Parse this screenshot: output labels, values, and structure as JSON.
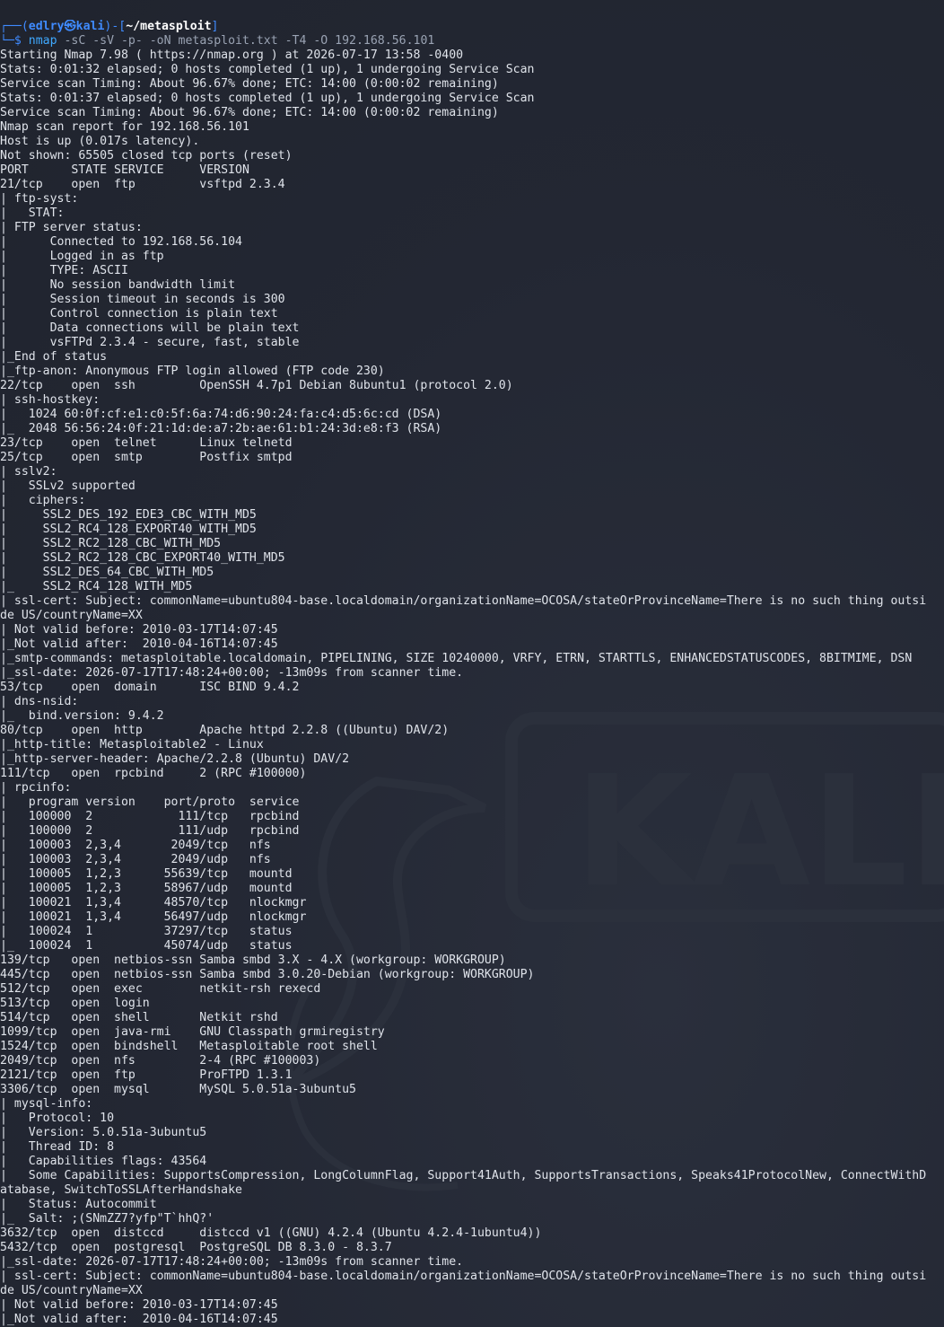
{
  "window": {
    "watermark_text": "KALI"
  },
  "prompt": {
    "open": "┌──(",
    "user": "edlry㉿kali",
    "mid": ")-[",
    "path": "~/metasploit",
    "close": "]",
    "arrow": "└─$ ",
    "command": "nmap",
    "args": " -sC -sV -p- -oN metasploit.txt -T4 -O 192.168.56.101"
  },
  "output_lines": [
    "Starting Nmap 7.98 ( https://nmap.org ) at 2026-07-17 13:58 -0400",
    "Stats: 0:01:32 elapsed; 0 hosts completed (1 up), 1 undergoing Service Scan",
    "Service scan Timing: About 96.67% done; ETC: 14:00 (0:00:02 remaining)",
    "Stats: 0:01:37 elapsed; 0 hosts completed (1 up), 1 undergoing Service Scan",
    "Service scan Timing: About 96.67% done; ETC: 14:00 (0:00:02 remaining)",
    "Nmap scan report for 192.168.56.101",
    "Host is up (0.017s latency).",
    "Not shown: 65505 closed tcp ports (reset)",
    "PORT      STATE SERVICE     VERSION",
    "21/tcp    open  ftp         vsftpd 2.3.4",
    "| ftp-syst:",
    "|   STAT:",
    "| FTP server status:",
    "|      Connected to 192.168.56.104",
    "|      Logged in as ftp",
    "|      TYPE: ASCII",
    "|      No session bandwidth limit",
    "|      Session timeout in seconds is 300",
    "|      Control connection is plain text",
    "|      Data connections will be plain text",
    "|      vsFTPd 2.3.4 - secure, fast, stable",
    "|_End of status",
    "|_ftp-anon: Anonymous FTP login allowed (FTP code 230)",
    "22/tcp    open  ssh         OpenSSH 4.7p1 Debian 8ubuntu1 (protocol 2.0)",
    "| ssh-hostkey:",
    "|   1024 60:0f:cf:e1:c0:5f:6a:74:d6:90:24:fa:c4:d5:6c:cd (DSA)",
    "|_  2048 56:56:24:0f:21:1d:de:a7:2b:ae:61:b1:24:3d:e8:f3 (RSA)",
    "23/tcp    open  telnet      Linux telnetd",
    "25/tcp    open  smtp        Postfix smtpd",
    "| sslv2:",
    "|   SSLv2 supported",
    "|   ciphers:",
    "|     SSL2_DES_192_EDE3_CBC_WITH_MD5",
    "|     SSL2_RC4_128_EXPORT40_WITH_MD5",
    "|     SSL2_RC2_128_CBC_WITH_MD5",
    "|     SSL2_RC2_128_CBC_EXPORT40_WITH_MD5",
    "|     SSL2_DES_64_CBC_WITH_MD5",
    "|_    SSL2_RC4_128_WITH_MD5",
    "| ssl-cert: Subject: commonName=ubuntu804-base.localdomain/organizationName=OCOSA/stateOrProvinceName=There is no such thing outsi",
    "de US/countryName=XX",
    "| Not valid before: 2010-03-17T14:07:45",
    "|_Not valid after:  2010-04-16T14:07:45",
    "|_smtp-commands: metasploitable.localdomain, PIPELINING, SIZE 10240000, VRFY, ETRN, STARTTLS, ENHANCEDSTATUSCODES, 8BITMIME, DSN",
    "|_ssl-date: 2026-07-17T17:48:24+00:00; -13m09s from scanner time.",
    "53/tcp    open  domain      ISC BIND 9.4.2",
    "| dns-nsid:",
    "|_  bind.version: 9.4.2",
    "80/tcp    open  http        Apache httpd 2.2.8 ((Ubuntu) DAV/2)",
    "|_http-title: Metasploitable2 - Linux",
    "|_http-server-header: Apache/2.2.8 (Ubuntu) DAV/2",
    "111/tcp   open  rpcbind     2 (RPC #100000)",
    "| rpcinfo:",
    "|   program version    port/proto  service",
    "|   100000  2            111/tcp   rpcbind",
    "|   100000  2            111/udp   rpcbind",
    "|   100003  2,3,4       2049/tcp   nfs",
    "|   100003  2,3,4       2049/udp   nfs",
    "|   100005  1,2,3      55639/tcp   mountd",
    "|   100005  1,2,3      58967/udp   mountd",
    "|   100021  1,3,4      48570/tcp   nlockmgr",
    "|   100021  1,3,4      56497/udp   nlockmgr",
    "|   100024  1          37297/tcp   status",
    "|_  100024  1          45074/udp   status",
    "139/tcp   open  netbios-ssn Samba smbd 3.X - 4.X (workgroup: WORKGROUP)",
    "445/tcp   open  netbios-ssn Samba smbd 3.0.20-Debian (workgroup: WORKGROUP)",
    "512/tcp   open  exec        netkit-rsh rexecd",
    "513/tcp   open  login",
    "514/tcp   open  shell       Netkit rshd",
    "1099/tcp  open  java-rmi    GNU Classpath grmiregistry",
    "1524/tcp  open  bindshell   Metasploitable root shell",
    "2049/tcp  open  nfs         2-4 (RPC #100003)",
    "2121/tcp  open  ftp         ProFTPD 1.3.1",
    "3306/tcp  open  mysql       MySQL 5.0.51a-3ubuntu5",
    "| mysql-info:",
    "|   Protocol: 10",
    "|   Version: 5.0.51a-3ubuntu5",
    "|   Thread ID: 8",
    "|   Capabilities flags: 43564",
    "|   Some Capabilities: SupportsCompression, LongColumnFlag, Support41Auth, SupportsTransactions, Speaks41ProtocolNew, ConnectWithD",
    "atabase, SwitchToSSLAfterHandshake",
    "|   Status: Autocommit",
    "|_  Salt: ;(SNmZZ7?yfp\"T`hhQ?'",
    "3632/tcp  open  distccd     distccd v1 ((GNU) 4.2.4 (Ubuntu 4.2.4-1ubuntu4))",
    "5432/tcp  open  postgresql  PostgreSQL DB 8.3.0 - 8.3.7",
    "|_ssl-date: 2026-07-17T17:48:24+00:00; -13m09s from scanner time.",
    "| ssl-cert: Subject: commonName=ubuntu804-base.localdomain/organizationName=OCOSA/stateOrProvinceName=There is no such thing outsi",
    "de US/countryName=XX",
    "| Not valid before: 2010-03-17T14:07:45",
    "|_Not valid after:  2010-04-16T14:07:45"
  ]
}
